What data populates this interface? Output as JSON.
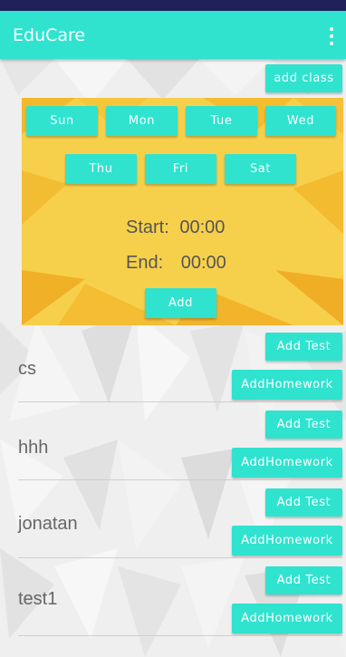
{
  "app": {
    "title": "EduCare"
  },
  "icons": {
    "menu": "overflow-menu-icon"
  },
  "colors": {
    "accent": "#2fe3cf",
    "appbar": "#2fe3cf",
    "panel": "#f7d04b"
  },
  "toolbar": {
    "add_class_label": "add class"
  },
  "schedule": {
    "days": [
      "Sun",
      "Mon",
      "Tue",
      "Wed",
      "Thu",
      "Fri",
      "Sat"
    ],
    "start_label": "Start:",
    "start_value": "00:00",
    "end_label": "End:",
    "end_value": "00:00",
    "add_label": "Add"
  },
  "classes": [
    {
      "name": "cs",
      "add_test": "Add Test",
      "add_homework": "AddHomework"
    },
    {
      "name": "hhh",
      "add_test": "Add Test",
      "add_homework": "AddHomework"
    },
    {
      "name": "jonatan",
      "add_test": "Add Test",
      "add_homework": "AddHomework"
    },
    {
      "name": "test1",
      "add_test": "Add Test",
      "add_homework": "AddHomework"
    }
  ]
}
